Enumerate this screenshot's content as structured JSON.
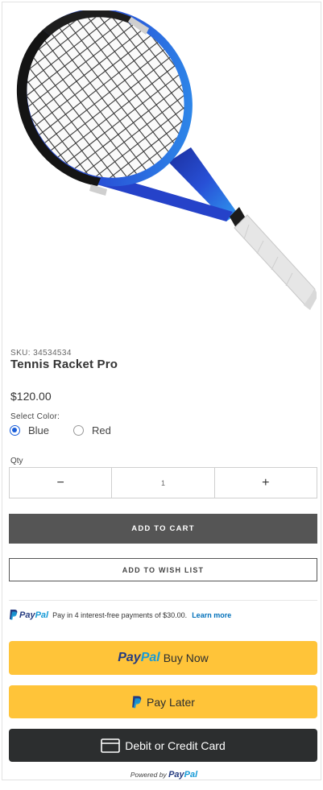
{
  "product": {
    "sku": "SKU: 34534534",
    "title": "Tennis Racket Pro",
    "price": "$120.00"
  },
  "color_selector": {
    "label": "Select Color:",
    "options": [
      {
        "label": "Blue",
        "selected": true
      },
      {
        "label": "Red",
        "selected": false
      }
    ]
  },
  "quantity": {
    "label": "Qty",
    "decrement": "−",
    "value": "1",
    "increment": "+"
  },
  "actions": {
    "add_to_cart": "ADD TO CART",
    "add_to_wish_list": "ADD TO WISH LIST"
  },
  "paypal": {
    "message_brand_1": "Pay",
    "message_brand_2": "Pal",
    "message_text": "Pay in 4 interest-free payments of $30.00.",
    "learn_more": "Learn more",
    "buy_now_brand_1": "Pay",
    "buy_now_brand_2": "Pal",
    "buy_now_label": "Buy Now",
    "pay_later_label": "Pay Later",
    "card_label": "Debit or Credit Card",
    "powered_by": "Powered by",
    "powered_brand_1": "Pay",
    "powered_brand_2": "Pal"
  },
  "colors": {
    "paypal_dark_blue": "#253b80",
    "paypal_light_blue": "#179bd7",
    "paypal_yellow": "#ffc439",
    "radio_blue": "#1a5ed9",
    "add_to_cart_bg": "#555555",
    "card_button_bg": "#2c2e2f"
  }
}
